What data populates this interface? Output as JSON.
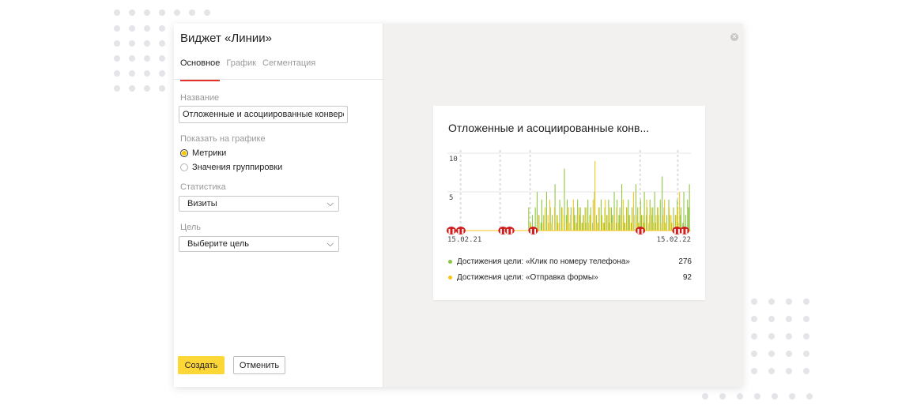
{
  "dialog": {
    "title": "Виджет «Линии»",
    "tabs": [
      {
        "label": "Основное",
        "active": true
      },
      {
        "label": "График",
        "active": false
      },
      {
        "label": "Сегментация",
        "active": false
      }
    ],
    "name_field": {
      "label": "Название",
      "value": "Отложенные и асоциированные конверс"
    },
    "show_on_chart": {
      "label": "Показать на графике",
      "options": [
        {
          "label": "Метрики",
          "checked": true
        },
        {
          "label": "Значения группировки",
          "checked": false
        }
      ]
    },
    "statistic": {
      "label": "Статистика",
      "value": "Визиты"
    },
    "goal": {
      "label": "Цель",
      "value": "Выберите цель"
    },
    "create_label": "Создать",
    "cancel_label": "Отменить",
    "close_icon": "close-icon"
  },
  "preview": {
    "title": "Отложенные и асоциированные конв...",
    "legend": [
      {
        "name": "Достижения цели: «Клик по номеру телефона»",
        "value": "276",
        "color": "#8cc63f"
      },
      {
        "name": "Достижения цели: «Отправка формы»",
        "value": "92",
        "color": "#f5c518"
      }
    ]
  },
  "colors": {
    "accent_yellow": "#fdd637",
    "tab_underline": "#e2332b",
    "annotation_red": "#d21d1d",
    "series_green": "#8cc63f",
    "series_yellow": "#f5c518"
  },
  "chart_data": {
    "type": "bar",
    "x_start": "15.02.21",
    "x_end": "15.02.22",
    "yticks": [
      "10",
      "5"
    ],
    "ylim": [
      0,
      10
    ],
    "grid": true,
    "series": [
      {
        "color": "#8cc63f",
        "values": [
          0,
          0,
          0,
          0,
          0,
          0,
          0,
          0,
          0,
          0,
          0,
          0,
          0,
          0,
          0,
          0,
          0,
          0,
          0,
          0,
          0,
          0,
          0,
          0,
          0,
          0,
          0,
          0,
          0,
          0,
          0,
          0,
          0,
          0,
          0,
          0,
          0,
          0,
          0,
          0,
          0,
          0,
          0,
          0,
          0,
          0,
          0,
          0,
          0,
          0,
          0,
          0,
          0,
          0,
          0,
          0,
          0,
          0,
          0,
          0,
          0,
          0,
          0,
          0,
          0,
          0,
          0,
          0,
          0,
          0,
          0,
          0,
          0,
          0,
          0,
          0,
          0,
          0,
          0,
          0,
          0,
          0,
          0,
          0,
          0,
          0,
          3,
          0,
          1,
          0,
          2,
          0,
          0,
          3,
          0,
          5,
          0,
          2,
          0,
          1,
          4,
          0,
          2,
          0,
          0,
          5,
          0,
          1,
          0,
          3,
          0,
          2,
          0,
          0,
          6,
          0,
          2,
          1,
          0,
          4,
          0,
          3,
          0,
          0,
          8,
          0,
          2,
          4,
          0,
          1,
          0,
          3,
          0,
          0,
          3,
          2,
          0,
          1,
          4,
          0,
          2,
          3,
          0,
          1,
          2,
          0,
          3,
          1,
          0,
          4,
          0,
          2,
          3,
          0,
          1,
          0,
          5,
          0,
          2,
          0,
          1,
          3,
          0,
          4,
          2,
          0,
          1,
          3,
          0,
          2,
          0,
          4,
          1,
          0,
          3,
          2,
          0,
          5,
          0,
          1,
          4,
          0,
          2,
          3,
          0,
          6,
          0,
          2,
          1,
          0,
          3,
          0,
          4,
          2,
          0,
          1,
          3,
          0,
          2,
          0,
          6,
          0,
          3,
          1,
          0,
          4,
          2,
          0,
          1,
          5,
          0,
          2,
          3,
          0,
          1,
          4,
          0,
          2,
          3,
          0,
          5,
          1,
          0,
          3,
          2,
          0,
          4,
          0,
          7,
          0,
          3,
          1,
          0,
          2,
          0,
          4,
          2,
          0,
          1,
          0,
          3,
          0,
          2,
          0,
          4,
          1,
          0,
          2,
          3,
          0,
          1,
          5,
          0,
          2,
          0,
          4,
          3,
          6,
          0
        ],
        "note": "Клик по номеру телефона"
      },
      {
        "color": "#f5c518",
        "values": [
          0,
          0,
          0,
          0,
          0,
          0,
          0,
          0,
          0,
          0,
          0,
          0,
          0,
          0,
          0,
          0,
          0,
          0,
          0,
          0,
          0,
          0,
          0,
          0,
          0,
          0,
          0,
          0,
          0,
          0,
          0,
          0,
          0,
          0,
          0,
          0,
          0,
          0,
          0,
          0,
          0,
          0,
          0,
          0,
          0,
          0,
          0,
          0,
          0,
          0,
          0,
          0,
          0,
          0,
          0,
          0,
          0,
          0,
          0,
          0,
          0,
          0,
          0,
          0,
          0,
          0,
          0,
          0,
          0,
          0,
          0,
          0,
          0,
          0,
          0,
          0,
          0,
          0,
          0,
          0,
          0,
          0,
          0,
          0,
          0,
          0,
          0,
          1,
          0,
          0,
          0,
          0,
          0,
          0,
          0,
          0,
          2,
          0,
          0,
          0,
          0,
          1,
          0,
          3,
          0,
          0,
          2,
          0,
          4,
          0,
          1,
          0,
          0,
          3,
          0,
          0,
          2,
          0,
          1,
          0,
          0,
          3,
          0,
          2,
          0,
          0,
          1,
          0,
          3,
          0,
          2,
          0,
          0,
          4,
          0,
          1,
          0,
          2,
          0,
          3,
          0,
          0,
          1,
          0,
          2,
          0,
          0,
          3,
          0,
          1,
          0,
          2,
          0,
          0,
          4,
          0,
          9,
          0,
          1,
          0,
          3,
          0,
          0,
          2,
          0,
          1,
          0,
          4,
          0,
          2,
          0,
          0,
          3,
          0,
          1,
          0,
          2,
          0,
          0,
          3,
          0,
          1,
          0,
          0,
          2,
          0,
          4,
          0,
          1,
          0,
          3,
          0,
          0,
          2,
          0,
          1,
          0,
          5,
          0,
          0,
          2,
          0,
          1,
          0,
          3,
          0,
          0,
          2,
          0,
          1,
          0,
          4,
          0,
          0,
          2,
          0,
          3,
          0,
          1,
          0,
          0,
          2,
          0,
          3,
          0,
          0,
          1,
          0,
          2,
          0,
          4,
          0,
          1,
          0,
          0,
          3,
          0,
          2,
          0,
          1,
          0,
          0,
          2,
          0,
          3,
          0,
          5,
          0,
          0
        ],
        "note": "Отправка формы"
      }
    ],
    "annotations": [
      {
        "day": 0
      },
      {
        "day": 10
      },
      {
        "day": 55
      },
      {
        "day": 62
      },
      {
        "day": 87
      },
      {
        "day": 201
      },
      {
        "day": 240
      },
      {
        "day": 248
      }
    ],
    "dashed_gridlines_days": [
      14,
      56,
      88,
      205,
      245
    ]
  }
}
